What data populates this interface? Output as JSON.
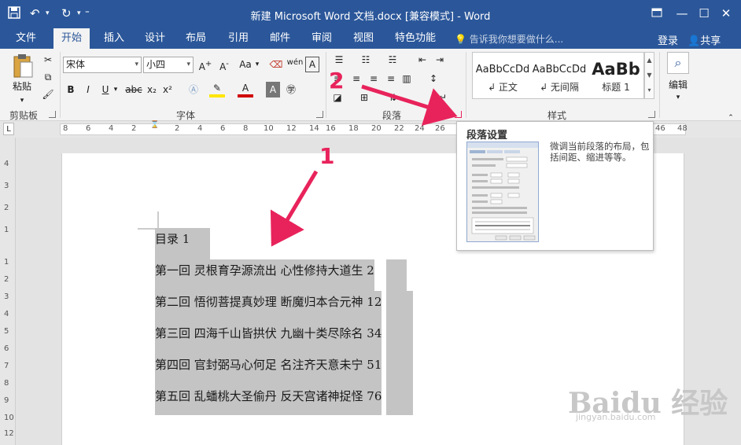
{
  "window": {
    "title": "新建 Microsoft Word 文档.docx [兼容模式] - Word",
    "quick_access": {
      "undo_label": "↶",
      "redo_label": "↻"
    }
  },
  "tabs": [
    {
      "label": "文件"
    },
    {
      "label": "开始"
    },
    {
      "label": "插入"
    },
    {
      "label": "设计"
    },
    {
      "label": "布局"
    },
    {
      "label": "引用"
    },
    {
      "label": "邮件"
    },
    {
      "label": "审阅"
    },
    {
      "label": "视图"
    },
    {
      "label": "特色功能"
    }
  ],
  "tell_me": "告诉我你想要做什么...",
  "account": {
    "login": "登录",
    "share": "共享"
  },
  "ribbon": {
    "clipboard": {
      "paste_label": "粘贴",
      "group_label": "剪贴板"
    },
    "font": {
      "font_name": "宋体",
      "font_size": "小四",
      "aa_label": "Aa",
      "bold": "B",
      "italic": "I",
      "underline": "U",
      "strike": "abc",
      "sub": "x₂",
      "sup": "x²",
      "group_label": "字体"
    },
    "paragraph": {
      "group_label": "段落"
    },
    "styles": {
      "items": [
        {
          "preview": "AaBbCcDd",
          "name": "↲ 正文"
        },
        {
          "preview": "AaBbCcDd",
          "name": "↲ 无间隔"
        },
        {
          "preview": "AaBb",
          "name": "标题 1"
        }
      ],
      "group_label": "样式"
    },
    "editing": {
      "label": "编辑"
    }
  },
  "ruler": {
    "numbers": [
      "8",
      "6",
      "4",
      "2",
      "2",
      "4",
      "6",
      "8",
      "10",
      "12",
      "14",
      "16",
      "18",
      "20",
      "22",
      "24",
      "26",
      "28",
      "46",
      "48"
    ]
  },
  "vruler": {
    "numbers": [
      "4",
      "3",
      "2",
      "1",
      "1",
      "2",
      "3",
      "4",
      "5",
      "6",
      "7",
      "8",
      "9",
      "10",
      "11",
      "12"
    ]
  },
  "document": {
    "lines": [
      {
        "text": "目录 1"
      },
      {
        "text": "第一回  灵根育孕源流出  心性修持大道生 2"
      },
      {
        "text": "第二回  悟彻菩提真妙理  断魔归本合元神 12"
      },
      {
        "text": "第三回  四海千山皆拱伏  九幽十类尽除名 34"
      },
      {
        "text": "第四回  官封弼马心何足  名注齐天意未宁 51"
      },
      {
        "text": "第五回  乱蟠桃大圣偷丹  反天宫诸神捉怪 76"
      }
    ]
  },
  "tooltip": {
    "title": "段落设置",
    "description": "微调当前段落的布局，包括间距、缩进等等。"
  },
  "annotations": {
    "one": "1",
    "two": "2"
  },
  "watermark": {
    "logo": "Baidu 经验",
    "url": "jingyan.baidu.com"
  }
}
